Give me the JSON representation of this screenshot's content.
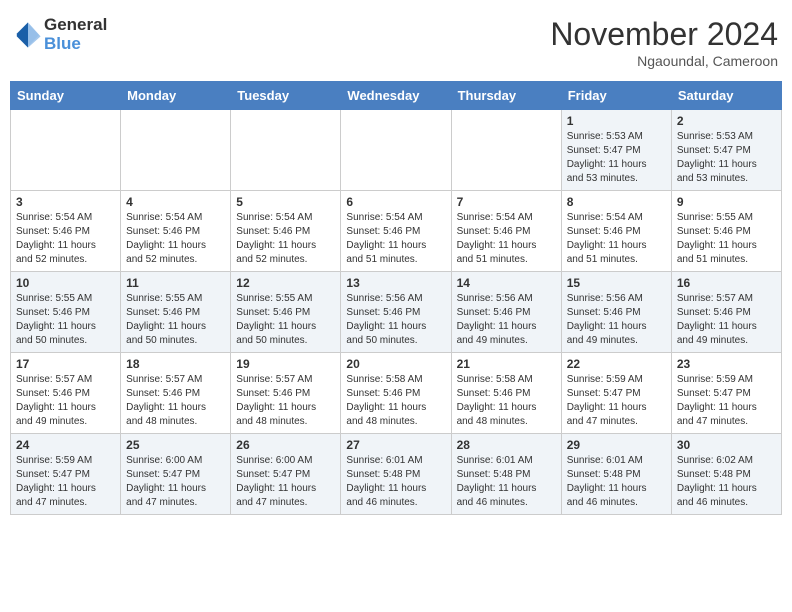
{
  "header": {
    "logo_general": "General",
    "logo_blue": "Blue",
    "month_title": "November 2024",
    "location": "Ngaoundal, Cameroon"
  },
  "days_of_week": [
    "Sunday",
    "Monday",
    "Tuesday",
    "Wednesday",
    "Thursday",
    "Friday",
    "Saturday"
  ],
  "weeks": [
    {
      "days": [
        {
          "num": "",
          "info": ""
        },
        {
          "num": "",
          "info": ""
        },
        {
          "num": "",
          "info": ""
        },
        {
          "num": "",
          "info": ""
        },
        {
          "num": "",
          "info": ""
        },
        {
          "num": "1",
          "info": "Sunrise: 5:53 AM\nSunset: 5:47 PM\nDaylight: 11 hours\nand 53 minutes."
        },
        {
          "num": "2",
          "info": "Sunrise: 5:53 AM\nSunset: 5:47 PM\nDaylight: 11 hours\nand 53 minutes."
        }
      ]
    },
    {
      "days": [
        {
          "num": "3",
          "info": "Sunrise: 5:54 AM\nSunset: 5:46 PM\nDaylight: 11 hours\nand 52 minutes."
        },
        {
          "num": "4",
          "info": "Sunrise: 5:54 AM\nSunset: 5:46 PM\nDaylight: 11 hours\nand 52 minutes."
        },
        {
          "num": "5",
          "info": "Sunrise: 5:54 AM\nSunset: 5:46 PM\nDaylight: 11 hours\nand 52 minutes."
        },
        {
          "num": "6",
          "info": "Sunrise: 5:54 AM\nSunset: 5:46 PM\nDaylight: 11 hours\nand 51 minutes."
        },
        {
          "num": "7",
          "info": "Sunrise: 5:54 AM\nSunset: 5:46 PM\nDaylight: 11 hours\nand 51 minutes."
        },
        {
          "num": "8",
          "info": "Sunrise: 5:54 AM\nSunset: 5:46 PM\nDaylight: 11 hours\nand 51 minutes."
        },
        {
          "num": "9",
          "info": "Sunrise: 5:55 AM\nSunset: 5:46 PM\nDaylight: 11 hours\nand 51 minutes."
        }
      ]
    },
    {
      "days": [
        {
          "num": "10",
          "info": "Sunrise: 5:55 AM\nSunset: 5:46 PM\nDaylight: 11 hours\nand 50 minutes."
        },
        {
          "num": "11",
          "info": "Sunrise: 5:55 AM\nSunset: 5:46 PM\nDaylight: 11 hours\nand 50 minutes."
        },
        {
          "num": "12",
          "info": "Sunrise: 5:55 AM\nSunset: 5:46 PM\nDaylight: 11 hours\nand 50 minutes."
        },
        {
          "num": "13",
          "info": "Sunrise: 5:56 AM\nSunset: 5:46 PM\nDaylight: 11 hours\nand 50 minutes."
        },
        {
          "num": "14",
          "info": "Sunrise: 5:56 AM\nSunset: 5:46 PM\nDaylight: 11 hours\nand 49 minutes."
        },
        {
          "num": "15",
          "info": "Sunrise: 5:56 AM\nSunset: 5:46 PM\nDaylight: 11 hours\nand 49 minutes."
        },
        {
          "num": "16",
          "info": "Sunrise: 5:57 AM\nSunset: 5:46 PM\nDaylight: 11 hours\nand 49 minutes."
        }
      ]
    },
    {
      "days": [
        {
          "num": "17",
          "info": "Sunrise: 5:57 AM\nSunset: 5:46 PM\nDaylight: 11 hours\nand 49 minutes."
        },
        {
          "num": "18",
          "info": "Sunrise: 5:57 AM\nSunset: 5:46 PM\nDaylight: 11 hours\nand 48 minutes."
        },
        {
          "num": "19",
          "info": "Sunrise: 5:57 AM\nSunset: 5:46 PM\nDaylight: 11 hours\nand 48 minutes."
        },
        {
          "num": "20",
          "info": "Sunrise: 5:58 AM\nSunset: 5:46 PM\nDaylight: 11 hours\nand 48 minutes."
        },
        {
          "num": "21",
          "info": "Sunrise: 5:58 AM\nSunset: 5:46 PM\nDaylight: 11 hours\nand 48 minutes."
        },
        {
          "num": "22",
          "info": "Sunrise: 5:59 AM\nSunset: 5:47 PM\nDaylight: 11 hours\nand 47 minutes."
        },
        {
          "num": "23",
          "info": "Sunrise: 5:59 AM\nSunset: 5:47 PM\nDaylight: 11 hours\nand 47 minutes."
        }
      ]
    },
    {
      "days": [
        {
          "num": "24",
          "info": "Sunrise: 5:59 AM\nSunset: 5:47 PM\nDaylight: 11 hours\nand 47 minutes."
        },
        {
          "num": "25",
          "info": "Sunrise: 6:00 AM\nSunset: 5:47 PM\nDaylight: 11 hours\nand 47 minutes."
        },
        {
          "num": "26",
          "info": "Sunrise: 6:00 AM\nSunset: 5:47 PM\nDaylight: 11 hours\nand 47 minutes."
        },
        {
          "num": "27",
          "info": "Sunrise: 6:01 AM\nSunset: 5:48 PM\nDaylight: 11 hours\nand 46 minutes."
        },
        {
          "num": "28",
          "info": "Sunrise: 6:01 AM\nSunset: 5:48 PM\nDaylight: 11 hours\nand 46 minutes."
        },
        {
          "num": "29",
          "info": "Sunrise: 6:01 AM\nSunset: 5:48 PM\nDaylight: 11 hours\nand 46 minutes."
        },
        {
          "num": "30",
          "info": "Sunrise: 6:02 AM\nSunset: 5:48 PM\nDaylight: 11 hours\nand 46 minutes."
        }
      ]
    }
  ]
}
